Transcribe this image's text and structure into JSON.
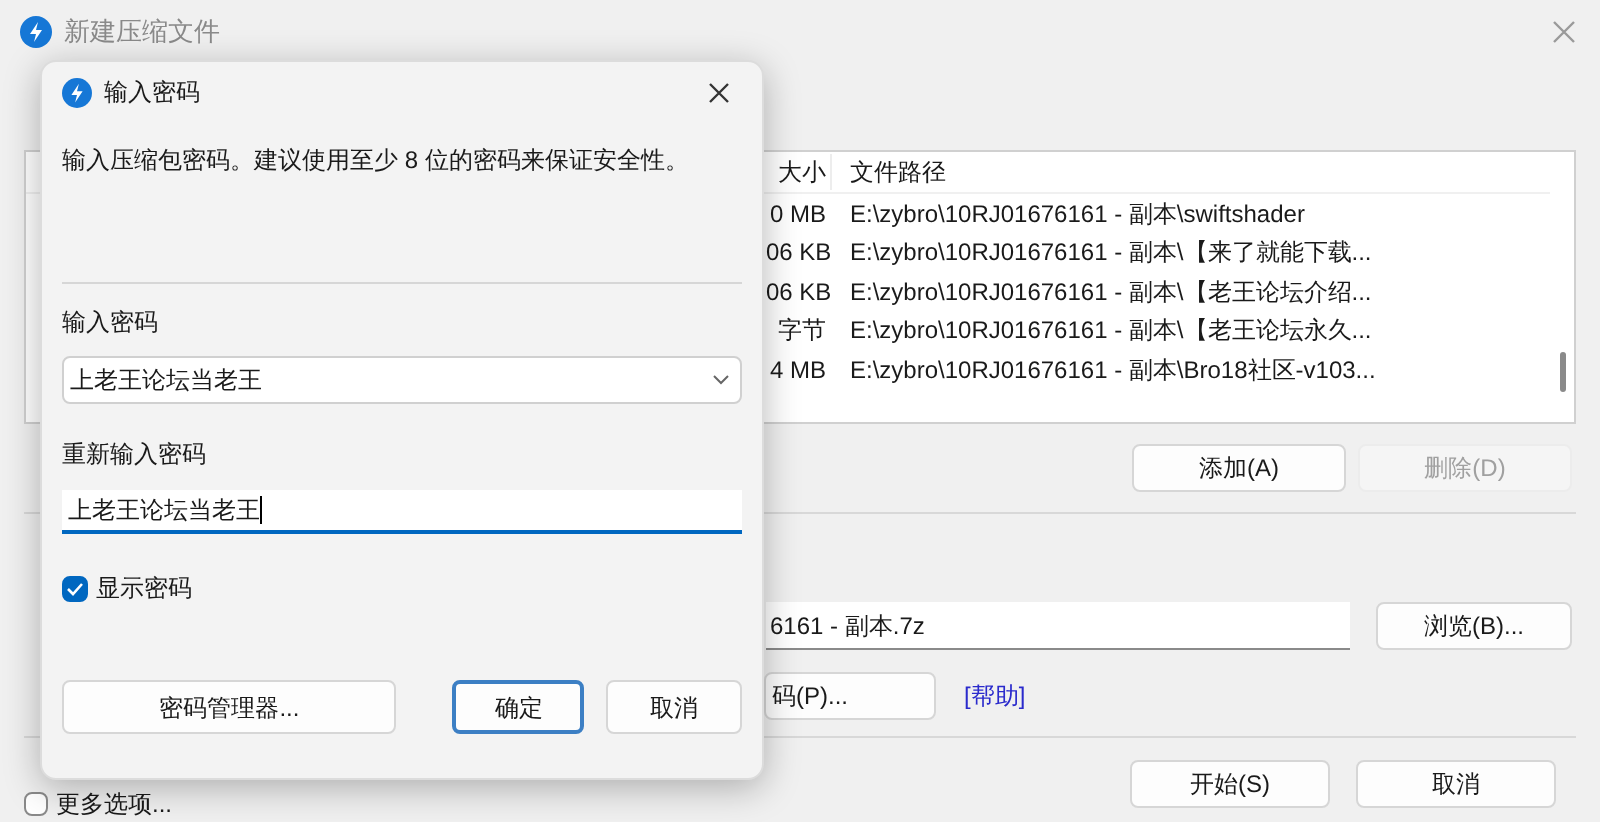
{
  "window": {
    "title": "新建压缩文件"
  },
  "file_list": {
    "columns": [
      "大小",
      "文件路径"
    ],
    "rows": [
      {
        "size": "0 MB",
        "path": "E:\\zybro\\10RJ01676161 - 副本\\swiftshader"
      },
      {
        "size": "06 KB",
        "path": "E:\\zybro\\10RJ01676161 - 副本\\【来了就能下载..."
      },
      {
        "size": "06 KB",
        "path": "E:\\zybro\\10RJ01676161 - 副本\\【老王论坛介绍..."
      },
      {
        "size": "字节",
        "path": "E:\\zybro\\10RJ01676161 - 副本\\【老王论坛永久..."
      },
      {
        "size": "4 MB",
        "path": "E:\\zybro\\10RJ01676161 - 副本\\Bro18社区-v103..."
      }
    ]
  },
  "list_buttons": [
    {
      "label": "添加(A)",
      "disabled": false
    },
    {
      "label": "删除(D)",
      "disabled": true
    }
  ],
  "output_file": {
    "value": "6161 - 副本.7z"
  },
  "browse_button": "浏览(B)...",
  "password_button": "码(P)...",
  "help_link": "[帮助]",
  "more_options": {
    "label": "更多选项...",
    "checked": false
  },
  "footer_buttons": [
    {
      "label": "开始(S)"
    },
    {
      "label": "取消"
    }
  ],
  "dialog": {
    "title": "输入密码",
    "message": "输入压缩包密码。建议使用至少 8 位的密码来保证安全性。",
    "password_label": "输入密码",
    "password_value": "上老王论坛当老王",
    "confirm_label": "重新输入密码",
    "confirm_value": "上老王论坛当老王",
    "show_password": {
      "label": "显示密码",
      "checked": true
    },
    "buttons": [
      {
        "label": "密码管理器...",
        "default": false,
        "kind": "wide"
      },
      {
        "label": "确定",
        "default": true,
        "kind": "normal"
      },
      {
        "label": "取消",
        "default": false,
        "kind": "normal"
      }
    ]
  }
}
